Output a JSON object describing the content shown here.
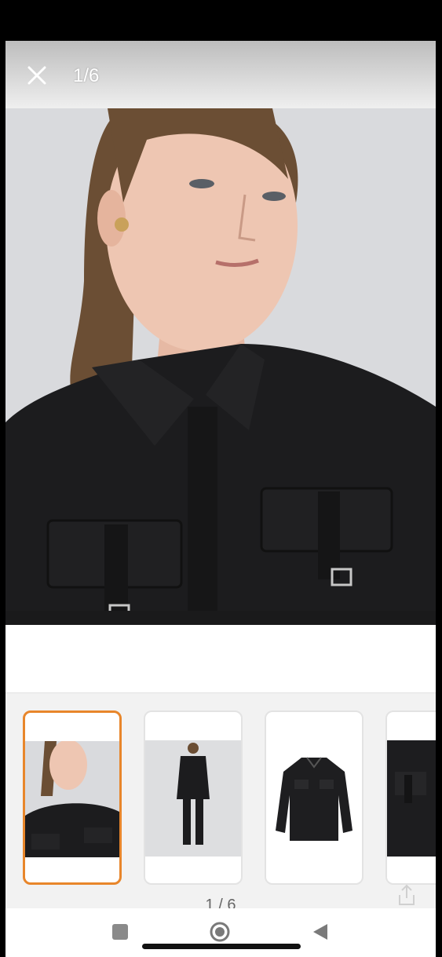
{
  "viewer": {
    "counter": "1/6",
    "pager": "1 / 6"
  },
  "icons": {
    "close": "close-icon",
    "share": "share-icon",
    "recents": "square-icon",
    "home": "circle-icon",
    "back": "triangle-back-icon"
  },
  "colors": {
    "selected_border": "#e8862b",
    "jacket": "#1c1c1e",
    "backdrop": "#d8d9dc"
  },
  "thumbnails": [
    {
      "label": "model-closeup",
      "selected": true
    },
    {
      "label": "model-full-body",
      "selected": false
    },
    {
      "label": "product-flat",
      "selected": false
    },
    {
      "label": "detail-pocket",
      "selected": false
    }
  ]
}
